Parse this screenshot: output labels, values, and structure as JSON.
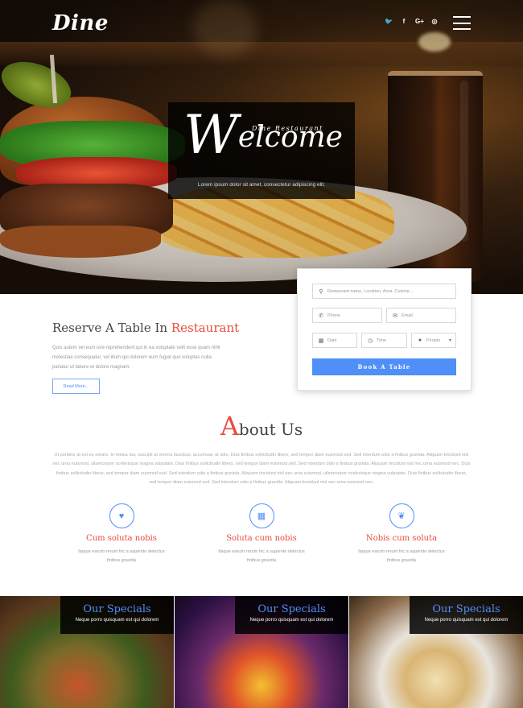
{
  "header": {
    "logo": "Dine",
    "social_icons": [
      "twitter-icon",
      "facebook-icon",
      "google-plus-icon",
      "dribbble-icon"
    ],
    "social_glyphs": [
      "🐦",
      "f",
      "G+",
      "◎"
    ]
  },
  "hero": {
    "subtitle": "Dine Restaurant",
    "title_cap": "W",
    "title_rest": "elcome",
    "tagline": "Lorem ipsum dolor sit amet, consectetur adipiscing elit."
  },
  "booking": {
    "search_placeholder": "Restaurant name, Location, Area, Cuisine...",
    "phone_placeholder": "Phone",
    "email_placeholder": "Email",
    "date_placeholder": "Date",
    "time_placeholder": "Time",
    "people_placeholder": "People",
    "book_label": "Book A Table"
  },
  "reserve": {
    "title_plain": "Reserve A Table In ",
    "title_highlight": "Restaurant",
    "text": "Quis autem vel eum iure reprehenderit qui in ea voluptate velit esse quam nihil molestiae consequatur, vel illum qui dolorem eum fugiat quo voluptas nulla pariatur ut labore et dolore magnam.",
    "read_more": "Read More..."
  },
  "about": {
    "title_cap": "A",
    "title_rest": "bout Us",
    "text": "Ut porttitor at est eu ornare. In metus dui, suscipit at viverra faucibus, accumsan at odio. Duis finibus sollicitudin libero, sed tempor diam euismod sed. Sed interdum odio a finibus gravida. Aliquam tincidunt nisl nec urna euismod, ullamcorper scelerisque magna vulputate. Duis finibus sollicitudin libero, sed tempor diam euismod sed. Sed interdum odio a finibus gravida. Aliquam tincidunt nisl nec urna euismod nec. Duis finibus sollicitudin libero, sed tempor diam euismod sed. Sed interdum odio a finibus gravida. Aliquam tincidunt nisl nec urna euismod, ullamcorper scelerisque magna vulputate. Duis finibus sollicitudin libero, sed tempor diam euismod sed. Sed interdum odio a finibus gravida. Aliquam tincidunt nisl nec urna euismod nec.",
    "features": [
      {
        "icon": "heart-icon",
        "glyph": "♥",
        "title": "Cum soluta nobis",
        "text": "Itaque earum rerum hic a sapiente delectus finibus gravida"
      },
      {
        "icon": "calendar-icon",
        "glyph": "▦",
        "title": "Soluta cum nobis",
        "text": "Itaque earum rerum hic a sapiente delectus finibus gravida"
      },
      {
        "icon": "leaf-icon",
        "glyph": "❦",
        "title": "Nobis cum soluta",
        "text": "Itaque earum rerum hic a sapiente delectus finibus gravida"
      }
    ]
  },
  "specials": [
    {
      "title": "Our Specials",
      "text": "Neque porro quisquam est qui dolorem"
    },
    {
      "title": "Our Specials",
      "text": "Neque porro quisquam est qui dolorem"
    },
    {
      "title": "Our Specials",
      "text": "Neque porro quisquam est qui dolorem"
    }
  ],
  "colors": {
    "accent_red": "#e84c3d",
    "accent_blue": "#4f8ff7",
    "dark": "#444444"
  }
}
